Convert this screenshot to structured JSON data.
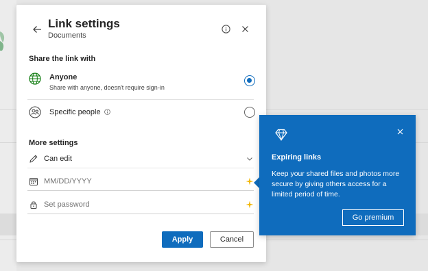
{
  "colors": {
    "accent": "#0f6cbd",
    "sparkle": "#f2b705",
    "globe": "#107c10"
  },
  "dialog": {
    "title": "Link settings",
    "subtitle": "Documents",
    "back_icon": "arrow-left-icon",
    "info_icon": "info-icon",
    "close_icon": "close-icon"
  },
  "share": {
    "section_label": "Share the link with",
    "options": [
      {
        "title": "Anyone",
        "description": "Share with anyone, doesn't require sign-in",
        "icon": "globe-icon",
        "selected": true
      },
      {
        "title": "Specific people",
        "description": "",
        "icon": "people-icon",
        "selected": false
      }
    ]
  },
  "more_settings": {
    "section_label": "More settings",
    "permission": {
      "value": "Can edit",
      "icon": "pencil-icon"
    },
    "expiry": {
      "placeholder": "MM/DD/YYYY",
      "icon": "calendar-icon"
    },
    "password": {
      "placeholder": "Set password",
      "icon": "lock-icon"
    }
  },
  "actions": {
    "apply_label": "Apply",
    "cancel_label": "Cancel"
  },
  "callout": {
    "title": "Expiring links",
    "body": "Keep your shared files and photos more secure by giving others access for a limited period of time.",
    "button_label": "Go premium",
    "icon": "diamond-icon"
  }
}
